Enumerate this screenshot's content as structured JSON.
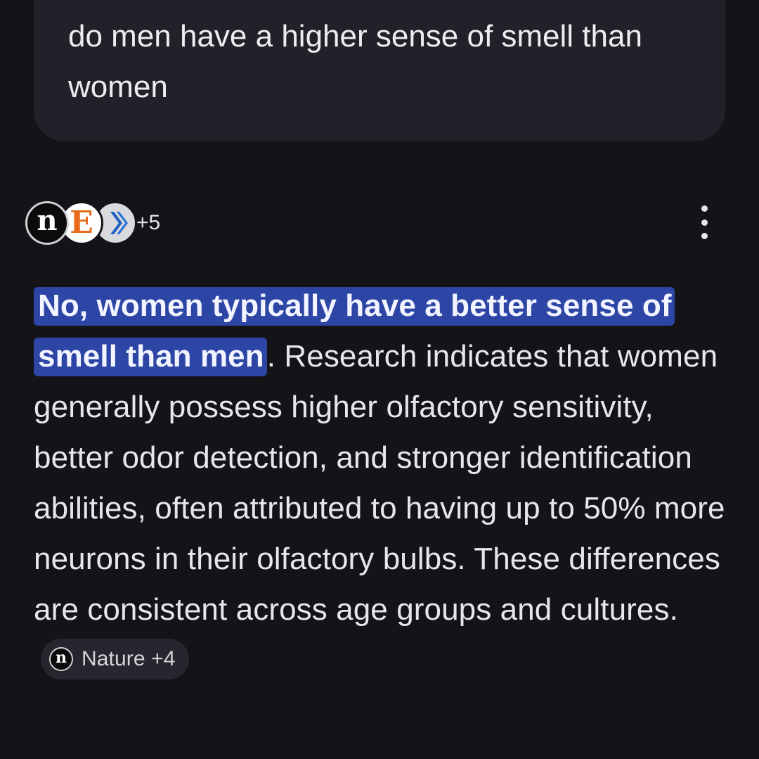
{
  "query": {
    "text": "do men have a higher sense of smell than women"
  },
  "sources": {
    "icons": [
      "nature-favicon",
      "e-favicon",
      "arrow-favicon"
    ],
    "nature_letter": "n",
    "e_letter": "E",
    "more_count": "+5"
  },
  "answer": {
    "highlight": "No, women typically have a better sense of smell than men",
    "body": ". Research indicates that women generally possess higher olfactory sensitivity, better odor detection, and stronger identification abilities, often attributed to having up to 50% more neurons in their olfactory bulbs. These differences are consistent across age groups and cultures.",
    "citation": {
      "icon_letter": "n",
      "label": "Nature +4"
    }
  },
  "colors": {
    "background": "#131318",
    "bubble": "#212129",
    "highlight": "#2d45a5",
    "chip": "#26262e"
  }
}
